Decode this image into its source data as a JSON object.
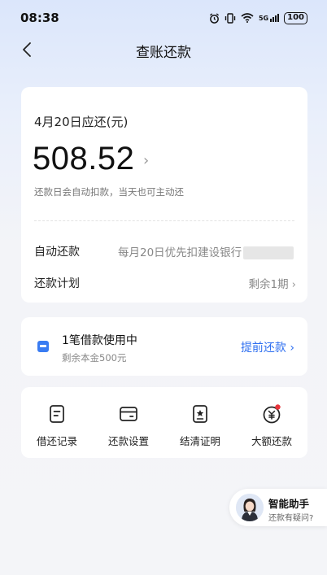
{
  "status_bar": {
    "time": "08:38",
    "icons": [
      "alarm-icon",
      "vibrate-icon",
      "wifi-icon",
      "signal-5g-icon"
    ],
    "network_label": "5G",
    "battery": "100"
  },
  "nav": {
    "title": "查账还款"
  },
  "due_card": {
    "due_label": "4月20日应还(元)",
    "amount": "508.52",
    "amount_chevron": "›",
    "note": "还款日会自动扣款，当天也可主动还",
    "auto_repay_label": "自动还款",
    "auto_repay_value": "每月20日优先扣建设银行",
    "plan_label": "还款计划",
    "plan_value": "剩余1期",
    "plan_chevron": "›"
  },
  "loan_card": {
    "title": "1笔借款使用中",
    "subtitle": "剩余本金500元",
    "action": "提前还款",
    "action_chevron": "›"
  },
  "functions": [
    {
      "label": "借还记录",
      "icon": "record-icon"
    },
    {
      "label": "还款设置",
      "icon": "card-settings-icon"
    },
    {
      "label": "结清证明",
      "icon": "certificate-icon"
    },
    {
      "label": "大额还款",
      "icon": "large-repay-icon"
    }
  ],
  "helper": {
    "title": "智能助手",
    "subtitle": "还款有疑问?"
  },
  "colors": {
    "accent": "#2e6ff0",
    "notification_dot": "#e8343a"
  }
}
